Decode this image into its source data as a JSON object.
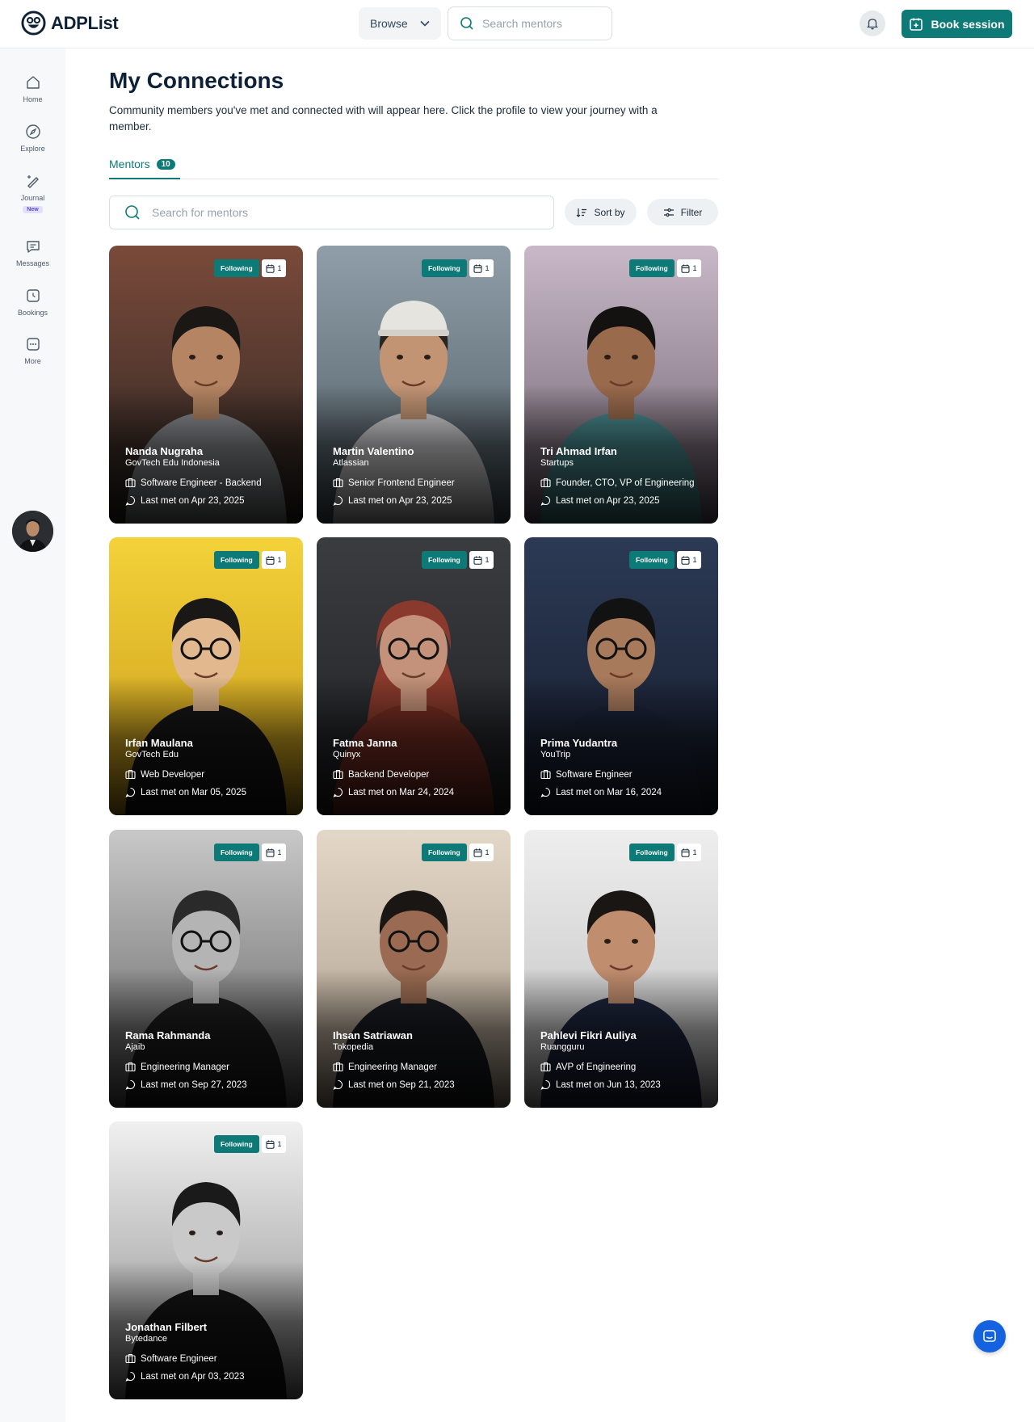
{
  "app": {
    "name": "ADPList"
  },
  "header": {
    "browse_label": "Browse",
    "search_placeholder": "Search mentors",
    "book_label": "Book session"
  },
  "sidebar": {
    "items": [
      {
        "label": "Home",
        "icon": "home-icon"
      },
      {
        "label": "Explore",
        "icon": "compass-icon"
      },
      {
        "label": "Journal",
        "icon": "pen-sparkle-icon",
        "badge": "New"
      },
      {
        "label": "Messages",
        "icon": "chat-icon"
      },
      {
        "label": "Bookings",
        "icon": "clock-icon"
      },
      {
        "label": "More",
        "icon": "ellipsis-icon"
      }
    ]
  },
  "page": {
    "title": "My Connections",
    "description": "Community members you've met and connected with will appear here. Click the profile to view your journey with a member.",
    "tab_label": "Mentors",
    "tab_count": "10",
    "search_placeholder": "Search for mentors",
    "sort_label": "Sort by",
    "filter_label": "Filter"
  },
  "mentors": [
    {
      "name": "Nanda Nugraha",
      "company": "GovTech Edu Indonesia",
      "role": "Software Engineer - Backend",
      "last_met": "Last met on Apr 23, 2025",
      "status": "Following",
      "sessions": "1"
    },
    {
      "name": "Martin Valentino",
      "company": "Atlassian",
      "role": "Senior Frontend Engineer",
      "last_met": "Last met on Apr 23, 2025",
      "status": "Following",
      "sessions": "1"
    },
    {
      "name": "Tri Ahmad Irfan",
      "company": "Startups",
      "role": "Founder, CTO, VP of Engineering",
      "last_met": "Last met on Apr 23, 2025",
      "status": "Following",
      "sessions": "1"
    },
    {
      "name": "Irfan Maulana",
      "company": "GovTech Edu",
      "role": "Web Developer",
      "last_met": "Last met on Mar 05, 2025",
      "status": "Following",
      "sessions": "1"
    },
    {
      "name": "Fatma Janna",
      "company": "Quinyx",
      "role": "Backend Developer",
      "last_met": "Last met on Mar 24, 2024",
      "status": "Following",
      "sessions": "1"
    },
    {
      "name": "Prima Yudantra",
      "company": "YouTrip",
      "role": "Software Engineer",
      "last_met": "Last met on Mar 16, 2024",
      "status": "Following",
      "sessions": "1"
    },
    {
      "name": "Rama Rahmanda",
      "company": "Ajaib",
      "role": "Engineering Manager",
      "last_met": "Last met on Sep 27, 2023",
      "status": "Following",
      "sessions": "1"
    },
    {
      "name": "Ihsan Satriawan",
      "company": "Tokopedia",
      "role": "Engineering Manager",
      "last_met": "Last met on Sep 21, 2023",
      "status": "Following",
      "sessions": "1"
    },
    {
      "name": "Pahlevi Fikri Auliya",
      "company": "Ruangguru",
      "role": "AVP of Engineering",
      "last_met": "Last met on Jun 13, 2023",
      "status": "Following",
      "sessions": "1"
    },
    {
      "name": "Jonathan Filbert",
      "company": "Bytedance",
      "role": "Software Engineer",
      "last_met": "Last met on Apr 03, 2023",
      "status": "Following",
      "sessions": "1"
    }
  ],
  "colors": {
    "accent": "#0d7a78",
    "chat_fab": "#1462e0"
  }
}
